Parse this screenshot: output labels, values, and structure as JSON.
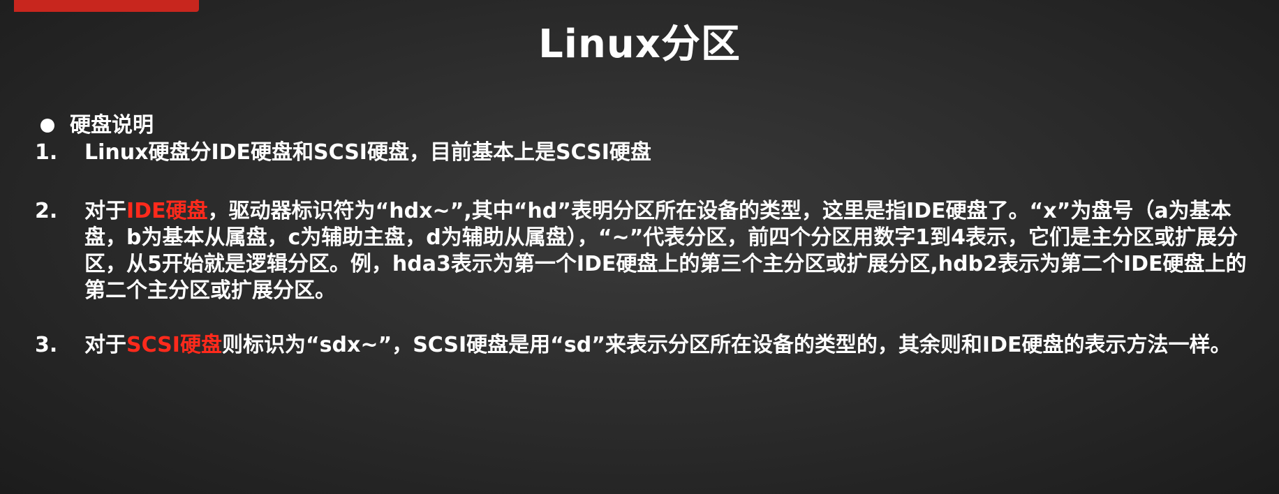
{
  "slide": {
    "title": "Linux分区",
    "accent_color": "#ff2a1c",
    "section_heading": "硬盘说明",
    "items": [
      {
        "number": "1.",
        "text": "Linux硬盘分IDE硬盘和SCSI硬盘，目前基本上是SCSI硬盘"
      },
      {
        "number": "2.",
        "prefix": "对于",
        "highlight": "IDE硬盘",
        "rest": "，驱动器标识符为“hdx~”,其中“hd”表明分区所在设备的类型，这里是指IDE硬盘了。“x”为盘号（a为基本盘，b为基本从属盘，c为辅助主盘，d为辅助从属盘），“~”代表分区，前四个分区用数字1到4表示，它们是主分区或扩展分区，从5开始就是逻辑分区。例，hda3表示为第一个IDE硬盘上的第三个主分区或扩展分区,hdb2表示为第二个IDE硬盘上的第二个主分区或扩展分区。"
      },
      {
        "number": "3.",
        "prefix": "对于",
        "highlight": "SCSI硬盘",
        "rest": "则标识为“sdx~”，SCSI硬盘是用“sd”来表示分区所在设备的类型的，其余则和IDE硬盘的表示方法一样。"
      }
    ]
  }
}
